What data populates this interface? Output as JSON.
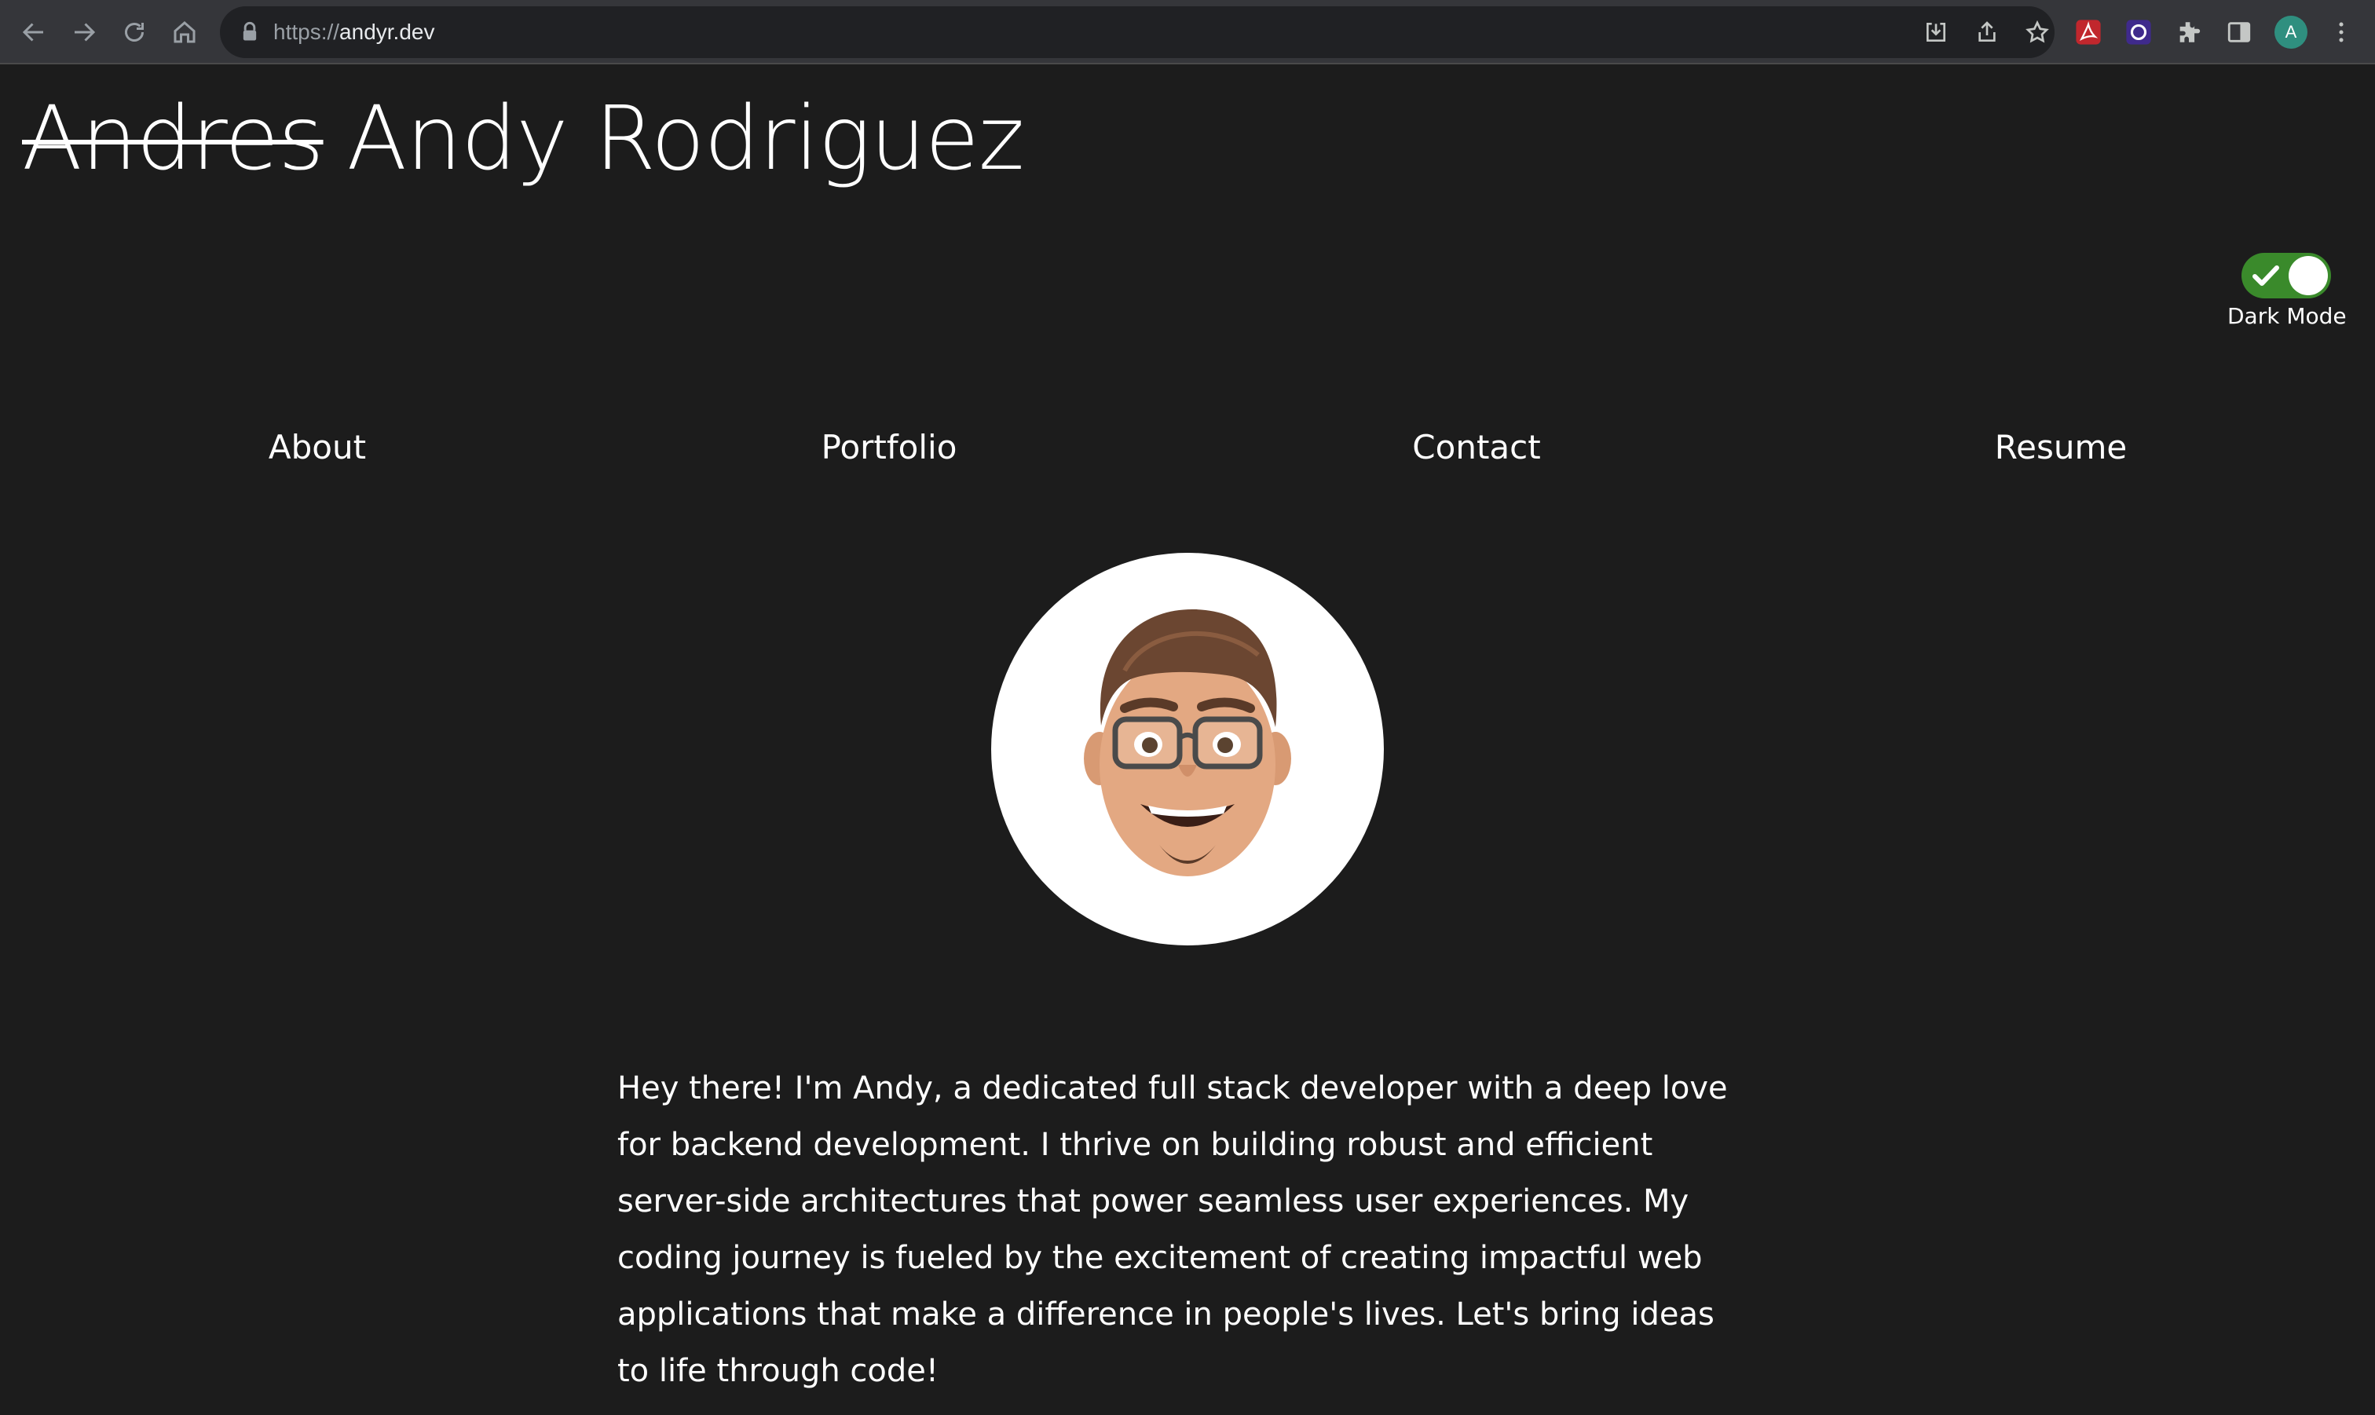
{
  "browser": {
    "url_scheme": "https://",
    "url_host": "andyr.dev",
    "profile_initial": "A",
    "icons": [
      "back-icon",
      "forward-icon",
      "reload-icon",
      "home-icon",
      "lock-icon",
      "install-icon",
      "share-icon",
      "bookmark-star-icon",
      "acrobat-extension-icon",
      "o-extension-icon",
      "puzzle-extensions-icon",
      "side-panel-icon",
      "kebab-menu-icon"
    ]
  },
  "site": {
    "old_name": "Andres",
    "name": "Andy Rodriguez",
    "dark_mode_label": "Dark Mode",
    "dark_mode_on": true,
    "toggle_color": "#3a8a2b",
    "background_color": "#1c1c1c",
    "text_color": "#ffffff"
  },
  "nav": {
    "items": [
      "About",
      "Portfolio",
      "Contact",
      "Resume"
    ]
  },
  "profile": {
    "icon": "memoji-avatar"
  },
  "bio": {
    "text": "Hey there! I'm Andy, a dedicated full stack developer with a deep love for backend development. I thrive on building robust and efficient server-side architectures that power seamless user experiences. My coding journey is fueled by the excitement of creating impactful web applications that make a difference in people's lives. Let's bring ideas to life through code!"
  }
}
